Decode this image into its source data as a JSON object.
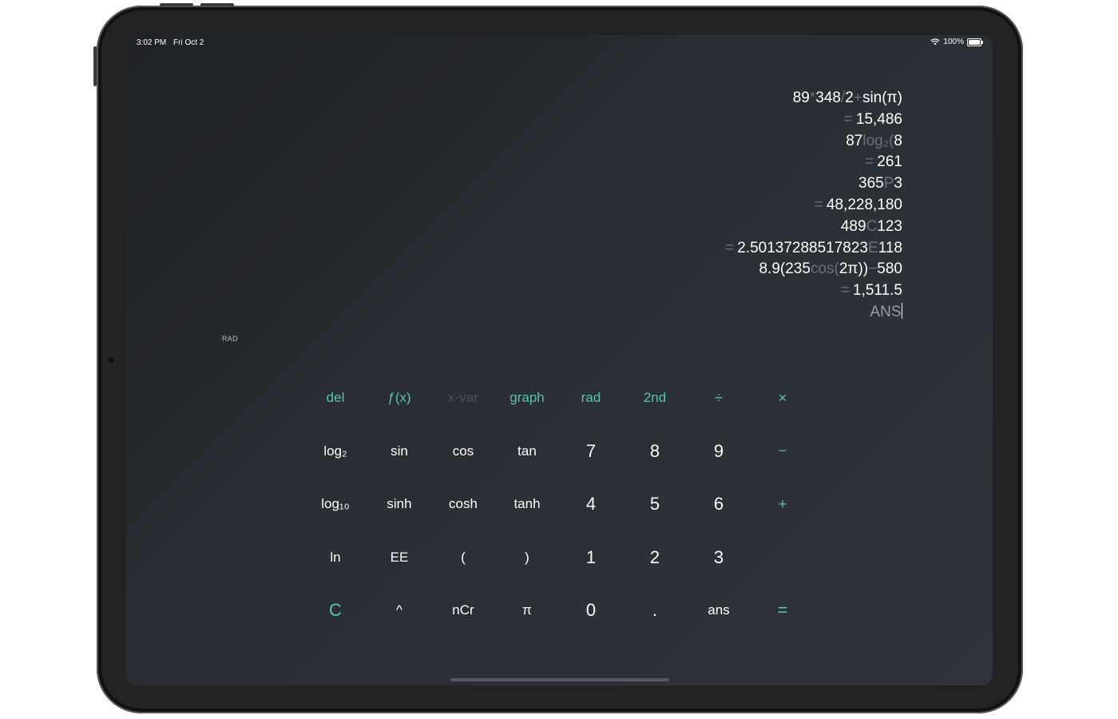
{
  "status_bar": {
    "time": "3:02 PM",
    "date": "Fri Oct 2",
    "battery_label": "100%",
    "battery_level": 1.0
  },
  "display": {
    "lines": [
      {
        "parts": [
          "89",
          "*",
          "348",
          "/",
          "2",
          "+",
          "sin(π)"
        ],
        "dim": [
          1,
          3,
          5
        ]
      },
      {
        "parts": [
          "=",
          "15,486"
        ],
        "dim": [
          0
        ]
      },
      {
        "parts": [
          "87",
          "log₂(",
          "8"
        ],
        "dim": [
          1
        ]
      },
      {
        "parts": [
          "=",
          "261"
        ],
        "dim": [
          0
        ]
      },
      {
        "parts": [
          "365",
          "P",
          "3"
        ],
        "dim": [
          1
        ]
      },
      {
        "parts": [
          "=",
          "48,228,180"
        ],
        "dim": [
          0
        ]
      },
      {
        "parts": [
          "489",
          "C",
          "123"
        ],
        "dim": [
          1
        ]
      },
      {
        "parts": [
          "=",
          "2.50137288517823",
          "E",
          "118"
        ],
        "dim": [
          0,
          2
        ]
      },
      {
        "parts": [
          "8.9(235",
          "cos(",
          "2π))",
          "−",
          "580"
        ],
        "dim": [
          1,
          3
        ]
      },
      {
        "parts": [
          "=",
          "1,511.5"
        ],
        "dim": [
          0
        ]
      }
    ],
    "current_input": "ANS",
    "angle_mode": "RAD"
  },
  "keypad": {
    "del": "del",
    "fx": "ƒ(x)",
    "x_var": "x-var",
    "graph": "graph",
    "rad": "rad",
    "second": "2nd",
    "divide": "÷",
    "multiply": "×",
    "log2": "log₂",
    "sin": "sin",
    "cos": "cos",
    "tan": "tan",
    "seven": "7",
    "eight": "8",
    "nine": "9",
    "minus": "−",
    "log10": "log₁₀",
    "sinh": "sinh",
    "cosh": "cosh",
    "tanh": "tanh",
    "four": "4",
    "five": "5",
    "six": "6",
    "plus": "+",
    "ln": "ln",
    "ee": "EE",
    "lparen": "(",
    "rparen": ")",
    "one": "1",
    "two": "2",
    "three": "3",
    "clear": "C",
    "power": "^",
    "ncr": "nCr",
    "pi": "π",
    "zero": "0",
    "decimal": ".",
    "ans": "ans",
    "equals": "="
  }
}
